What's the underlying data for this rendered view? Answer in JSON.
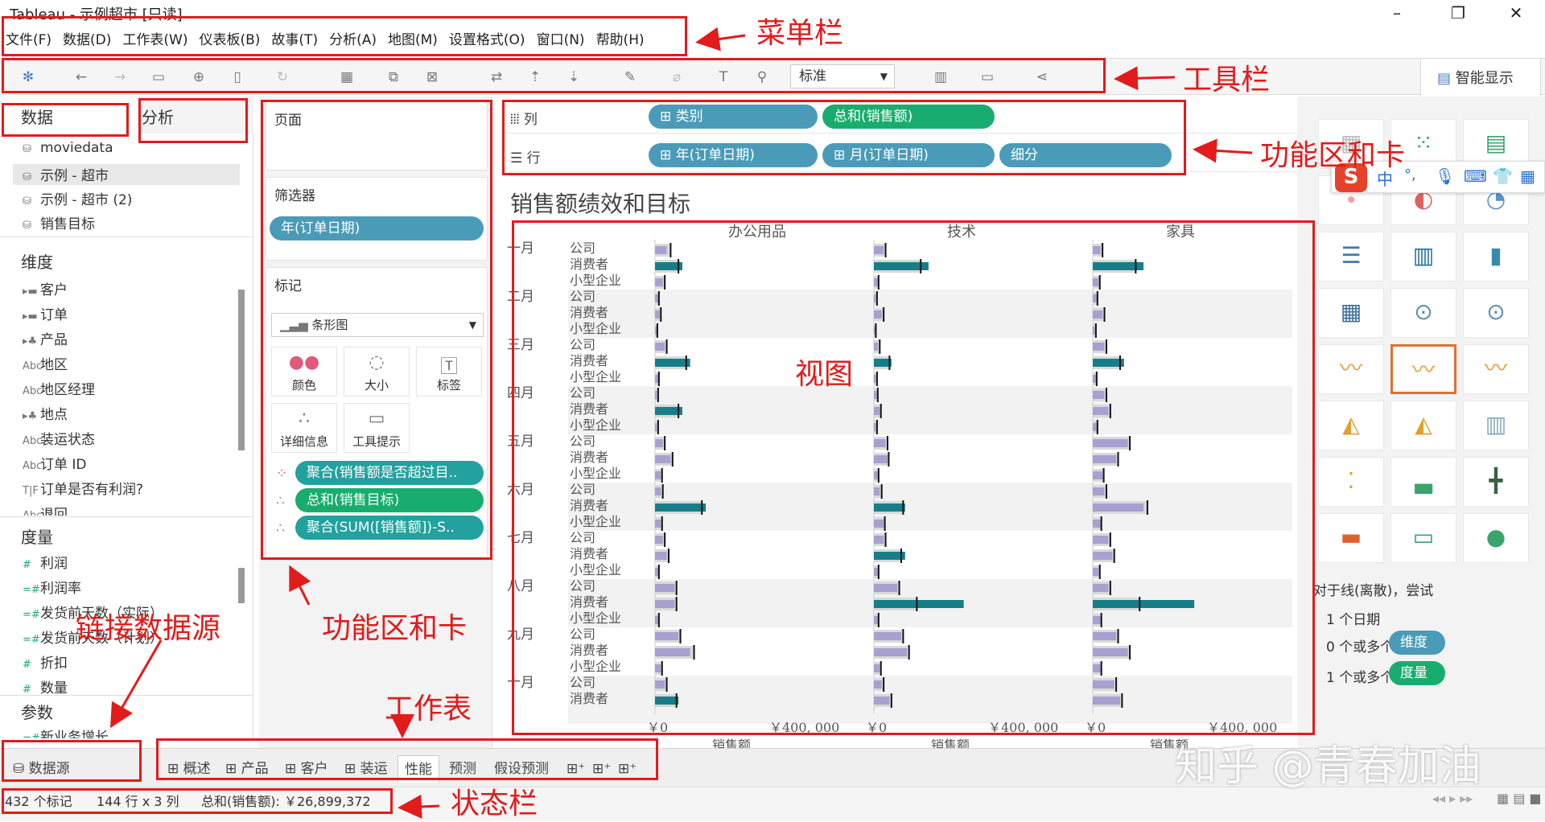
{
  "titlebar": {
    "title": "Tableau - 示例超市 [只读]"
  },
  "menu": [
    "文件(F)",
    "数据(D)",
    "工作表(W)",
    "仪表板(B)",
    "故事(T)",
    "分析(A)",
    "地图(M)",
    "设置格式(O)",
    "窗口(N)",
    "帮助(H)"
  ],
  "toolbar": {
    "fit_value": "标准"
  },
  "showme_tab": "智能显示",
  "left": {
    "data_tab": "数据",
    "analysis_tab": "分析",
    "sources": [
      "moviedata",
      "示例 - 超市",
      "示例 - 超市 (2)",
      "销售目标"
    ],
    "dimensions_header": "维度",
    "dimensions": [
      "客户",
      "订单",
      "产品",
      "地区",
      "地区经理",
      "地点",
      "装运状态",
      "订单 ID",
      "订单是否有利润?",
      "退回"
    ],
    "measures_header": "度量",
    "measures": [
      "利润",
      "利润率",
      "发货前天数（实际）",
      "发货前天数（计划）",
      "折扣",
      "数量"
    ],
    "params_header": "参数",
    "params": [
      "新业务增长"
    ]
  },
  "cards": {
    "pages": "页面",
    "filters": "筛选器",
    "filter_pill": "年(订单日期)",
    "marks": "标记",
    "mark_type": "条形图",
    "mark_buttons": [
      "颜色",
      "大小",
      "标签",
      "详细信息",
      "工具提示"
    ],
    "mark_pills": [
      "聚合(销售额是否超过目..",
      "总和(销售目标)",
      "聚合(SUM([销售额])-S.."
    ]
  },
  "shelves": {
    "columns_label": "列",
    "rows_label": "行",
    "columns": [
      "类别",
      "总和(销售额)"
    ],
    "rows": [
      "年(订单日期)",
      "月(订单日期)",
      "细分"
    ]
  },
  "view": {
    "title": "销售额绩效和目标"
  },
  "chart_data": {
    "type": "bar",
    "title": "销售额绩效和目标",
    "panels": [
      "办公用品",
      "技术",
      "家具"
    ],
    "months": [
      "一月",
      "二月",
      "三月",
      "四月",
      "五月",
      "六月",
      "七月",
      "八月",
      "九月",
      "十月"
    ],
    "segments": [
      "公司",
      "消费者",
      "小型企业"
    ],
    "xlabel": "销售额",
    "xticks": [
      "￥0",
      "￥400, 000"
    ],
    "xlim": [
      0,
      540000
    ],
    "series": [
      {
        "panel": "办公用品",
        "actual": [
          [
            30000,
            70000,
            20000
          ],
          [
            8000,
            12000,
            5000
          ],
          [
            25000,
            90000,
            8000
          ],
          [
            5000,
            70000,
            5000
          ],
          [
            20000,
            40000,
            15000
          ],
          [
            15000,
            130000,
            15000
          ],
          [
            20000,
            30000,
            8000
          ],
          [
            50000,
            50000,
            8000
          ],
          [
            60000,
            90000,
            15000
          ],
          [
            25000,
            60000,
            15000
          ]
        ],
        "target": [
          [
            40000,
            60000,
            25000
          ],
          [
            10000,
            15000,
            6000
          ],
          [
            30000,
            80000,
            10000
          ],
          [
            8000,
            60000,
            8000
          ],
          [
            25000,
            45000,
            18000
          ],
          [
            20000,
            120000,
            18000
          ],
          [
            25000,
            35000,
            10000
          ],
          [
            55000,
            55000,
            10000
          ],
          [
            65000,
            100000,
            18000
          ],
          [
            30000,
            55000,
            18000
          ]
        ]
      },
      {
        "panel": "技术",
        "actual": [
          [
            25000,
            140000,
            10000
          ],
          [
            5000,
            20000,
            3000
          ],
          [
            10000,
            45000,
            5000
          ],
          [
            8000,
            15000,
            5000
          ],
          [
            30000,
            35000,
            10000
          ],
          [
            15000,
            80000,
            25000
          ],
          [
            25000,
            80000,
            10000
          ],
          [
            60000,
            230000,
            10000
          ],
          [
            70000,
            85000,
            15000
          ],
          [
            20000,
            40000,
            10000
          ]
        ],
        "target": [
          [
            30000,
            120000,
            12000
          ],
          [
            8000,
            25000,
            5000
          ],
          [
            15000,
            40000,
            8000
          ],
          [
            10000,
            18000,
            8000
          ],
          [
            35000,
            38000,
            12000
          ],
          [
            20000,
            75000,
            28000
          ],
          [
            30000,
            70000,
            12000
          ],
          [
            65000,
            110000,
            12000
          ],
          [
            75000,
            90000,
            18000
          ],
          [
            25000,
            45000,
            12000
          ]
        ]
      },
      {
        "panel": "家具",
        "actual": [
          [
            20000,
            130000,
            15000
          ],
          [
            10000,
            25000,
            5000
          ],
          [
            30000,
            80000,
            8000
          ],
          [
            30000,
            40000,
            10000
          ],
          [
            90000,
            60000,
            25000
          ],
          [
            30000,
            130000,
            20000
          ],
          [
            40000,
            50000,
            15000
          ],
          [
            40000,
            260000,
            20000
          ],
          [
            60000,
            90000,
            20000
          ],
          [
            55000,
            70000,
            10000
          ]
        ],
        "target": [
          [
            25000,
            110000,
            18000
          ],
          [
            12000,
            30000,
            8000
          ],
          [
            35000,
            70000,
            10000
          ],
          [
            35000,
            45000,
            12000
          ],
          [
            95000,
            65000,
            28000
          ],
          [
            35000,
            140000,
            22000
          ],
          [
            45000,
            55000,
            18000
          ],
          [
            45000,
            120000,
            22000
          ],
          [
            65000,
            95000,
            22000
          ],
          [
            60000,
            75000,
            12000
          ]
        ]
      }
    ]
  },
  "tabs": [
    "数据源",
    "概述",
    "产品",
    "客户",
    "装运",
    "性能",
    "预测",
    "假设预测"
  ],
  "status": {
    "marks": "432 个标记",
    "dims": "144 行 x 3 列",
    "sum": "总和(销售额): ￥26,899,372"
  },
  "showme": {
    "hint": "对于线(离散)，尝试",
    "l1": "1 个日期",
    "l2": "0 个或多个",
    "l2pill": "维度",
    "l3": "1 个或多个",
    "l3pill": "度量"
  },
  "annotations": {
    "menubar": "菜单栏",
    "toolbar": "工具栏",
    "shelves": "功能区和卡",
    "cards": "功能区和卡",
    "view": "视图",
    "worksheet": "工作表",
    "datasource": "链接数据源",
    "statusbar": "状态栏"
  },
  "watermark": "知乎 @青春加油",
  "ime": [
    "中",
    "°,"
  ],
  "colors": {
    "teal": "#23a19e",
    "dim": "#4a9bb8",
    "green": "#18ad6e",
    "bar_good": "#177e89",
    "bar_bad": "#a8a0d0",
    "target_bg": "#d9d9d9",
    "annot": "#e21b1b"
  }
}
